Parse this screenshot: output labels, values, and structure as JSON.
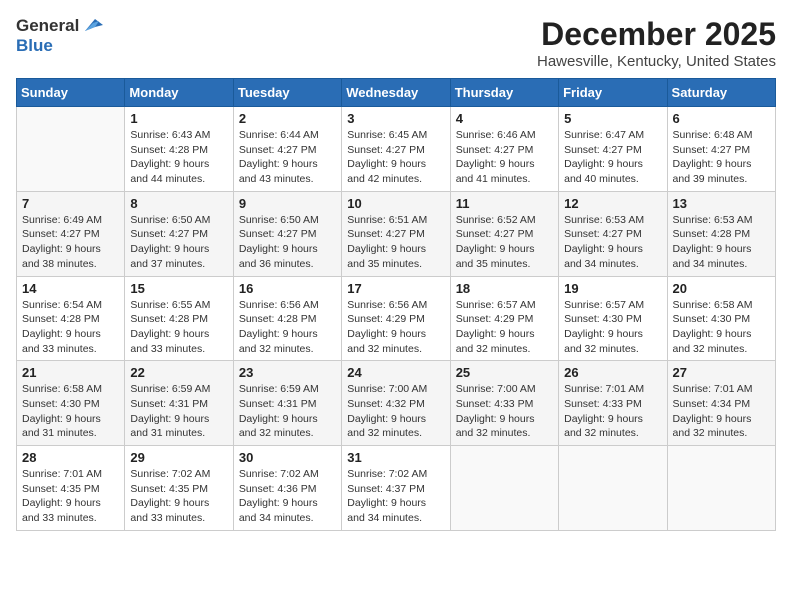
{
  "header": {
    "logo_line1": "General",
    "logo_line2": "Blue",
    "month_title": "December 2025",
    "location": "Hawesville, Kentucky, United States"
  },
  "calendar": {
    "days_of_week": [
      "Sunday",
      "Monday",
      "Tuesday",
      "Wednesday",
      "Thursday",
      "Friday",
      "Saturday"
    ],
    "weeks": [
      [
        {
          "day": "",
          "info": ""
        },
        {
          "day": "1",
          "info": "Sunrise: 6:43 AM\nSunset: 4:28 PM\nDaylight: 9 hours\nand 44 minutes."
        },
        {
          "day": "2",
          "info": "Sunrise: 6:44 AM\nSunset: 4:27 PM\nDaylight: 9 hours\nand 43 minutes."
        },
        {
          "day": "3",
          "info": "Sunrise: 6:45 AM\nSunset: 4:27 PM\nDaylight: 9 hours\nand 42 minutes."
        },
        {
          "day": "4",
          "info": "Sunrise: 6:46 AM\nSunset: 4:27 PM\nDaylight: 9 hours\nand 41 minutes."
        },
        {
          "day": "5",
          "info": "Sunrise: 6:47 AM\nSunset: 4:27 PM\nDaylight: 9 hours\nand 40 minutes."
        },
        {
          "day": "6",
          "info": "Sunrise: 6:48 AM\nSunset: 4:27 PM\nDaylight: 9 hours\nand 39 minutes."
        }
      ],
      [
        {
          "day": "7",
          "info": "Sunrise: 6:49 AM\nSunset: 4:27 PM\nDaylight: 9 hours\nand 38 minutes."
        },
        {
          "day": "8",
          "info": "Sunrise: 6:50 AM\nSunset: 4:27 PM\nDaylight: 9 hours\nand 37 minutes."
        },
        {
          "day": "9",
          "info": "Sunrise: 6:50 AM\nSunset: 4:27 PM\nDaylight: 9 hours\nand 36 minutes."
        },
        {
          "day": "10",
          "info": "Sunrise: 6:51 AM\nSunset: 4:27 PM\nDaylight: 9 hours\nand 35 minutes."
        },
        {
          "day": "11",
          "info": "Sunrise: 6:52 AM\nSunset: 4:27 PM\nDaylight: 9 hours\nand 35 minutes."
        },
        {
          "day": "12",
          "info": "Sunrise: 6:53 AM\nSunset: 4:27 PM\nDaylight: 9 hours\nand 34 minutes."
        },
        {
          "day": "13",
          "info": "Sunrise: 6:53 AM\nSunset: 4:28 PM\nDaylight: 9 hours\nand 34 minutes."
        }
      ],
      [
        {
          "day": "14",
          "info": "Sunrise: 6:54 AM\nSunset: 4:28 PM\nDaylight: 9 hours\nand 33 minutes."
        },
        {
          "day": "15",
          "info": "Sunrise: 6:55 AM\nSunset: 4:28 PM\nDaylight: 9 hours\nand 33 minutes."
        },
        {
          "day": "16",
          "info": "Sunrise: 6:56 AM\nSunset: 4:28 PM\nDaylight: 9 hours\nand 32 minutes."
        },
        {
          "day": "17",
          "info": "Sunrise: 6:56 AM\nSunset: 4:29 PM\nDaylight: 9 hours\nand 32 minutes."
        },
        {
          "day": "18",
          "info": "Sunrise: 6:57 AM\nSunset: 4:29 PM\nDaylight: 9 hours\nand 32 minutes."
        },
        {
          "day": "19",
          "info": "Sunrise: 6:57 AM\nSunset: 4:30 PM\nDaylight: 9 hours\nand 32 minutes."
        },
        {
          "day": "20",
          "info": "Sunrise: 6:58 AM\nSunset: 4:30 PM\nDaylight: 9 hours\nand 32 minutes."
        }
      ],
      [
        {
          "day": "21",
          "info": "Sunrise: 6:58 AM\nSunset: 4:30 PM\nDaylight: 9 hours\nand 31 minutes."
        },
        {
          "day": "22",
          "info": "Sunrise: 6:59 AM\nSunset: 4:31 PM\nDaylight: 9 hours\nand 31 minutes."
        },
        {
          "day": "23",
          "info": "Sunrise: 6:59 AM\nSunset: 4:31 PM\nDaylight: 9 hours\nand 32 minutes."
        },
        {
          "day": "24",
          "info": "Sunrise: 7:00 AM\nSunset: 4:32 PM\nDaylight: 9 hours\nand 32 minutes."
        },
        {
          "day": "25",
          "info": "Sunrise: 7:00 AM\nSunset: 4:33 PM\nDaylight: 9 hours\nand 32 minutes."
        },
        {
          "day": "26",
          "info": "Sunrise: 7:01 AM\nSunset: 4:33 PM\nDaylight: 9 hours\nand 32 minutes."
        },
        {
          "day": "27",
          "info": "Sunrise: 7:01 AM\nSunset: 4:34 PM\nDaylight: 9 hours\nand 32 minutes."
        }
      ],
      [
        {
          "day": "28",
          "info": "Sunrise: 7:01 AM\nSunset: 4:35 PM\nDaylight: 9 hours\nand 33 minutes."
        },
        {
          "day": "29",
          "info": "Sunrise: 7:02 AM\nSunset: 4:35 PM\nDaylight: 9 hours\nand 33 minutes."
        },
        {
          "day": "30",
          "info": "Sunrise: 7:02 AM\nSunset: 4:36 PM\nDaylight: 9 hours\nand 34 minutes."
        },
        {
          "day": "31",
          "info": "Sunrise: 7:02 AM\nSunset: 4:37 PM\nDaylight: 9 hours\nand 34 minutes."
        },
        {
          "day": "",
          "info": ""
        },
        {
          "day": "",
          "info": ""
        },
        {
          "day": "",
          "info": ""
        }
      ]
    ]
  }
}
